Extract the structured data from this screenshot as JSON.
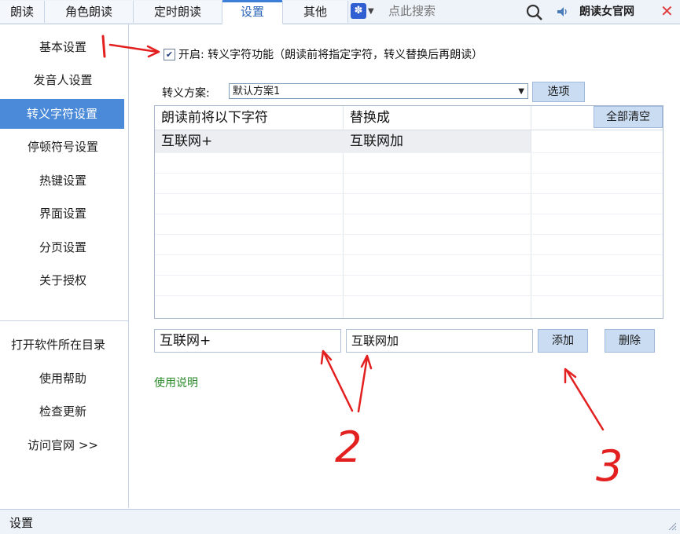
{
  "tabs": [
    "朗读",
    "角色朗读",
    "定时朗读",
    "设置",
    "其他"
  ],
  "search": {
    "placeholder": "点此搜索"
  },
  "site_link": "朗读女官网",
  "sidebar": {
    "items": [
      "基本设置",
      "发音人设置",
      "转义字符设置",
      "停顿符号设置",
      "热键设置",
      "界面设置",
      "分页设置",
      "关于授权"
    ],
    "bottom_items": [
      "打开软件所在目录",
      "使用帮助",
      "检查更新",
      "访问官网 >>"
    ]
  },
  "main": {
    "enable_label": "开启: 转义字符功能（朗读前将指定字符，转义替换后再朗读）",
    "scheme_label": "转义方案:",
    "scheme_value": "默认方案1",
    "options_button": "选项",
    "table": {
      "headers": [
        "朗读前将以下字符",
        "替换成"
      ],
      "clear_button": "全部清空",
      "rows": [
        [
          "互联网+",
          "互联网加"
        ]
      ]
    },
    "input_source": "互联网+",
    "input_target": "互联网加",
    "add_button": "添加",
    "delete_button": "删除",
    "help_link": "使用说明"
  },
  "status": {
    "text": "设置"
  },
  "annotations": [
    "1",
    "2",
    "3"
  ],
  "colors": {
    "accent": "#4a8ad9",
    "annotation": "#e32020",
    "link": "#2a8a2a"
  }
}
